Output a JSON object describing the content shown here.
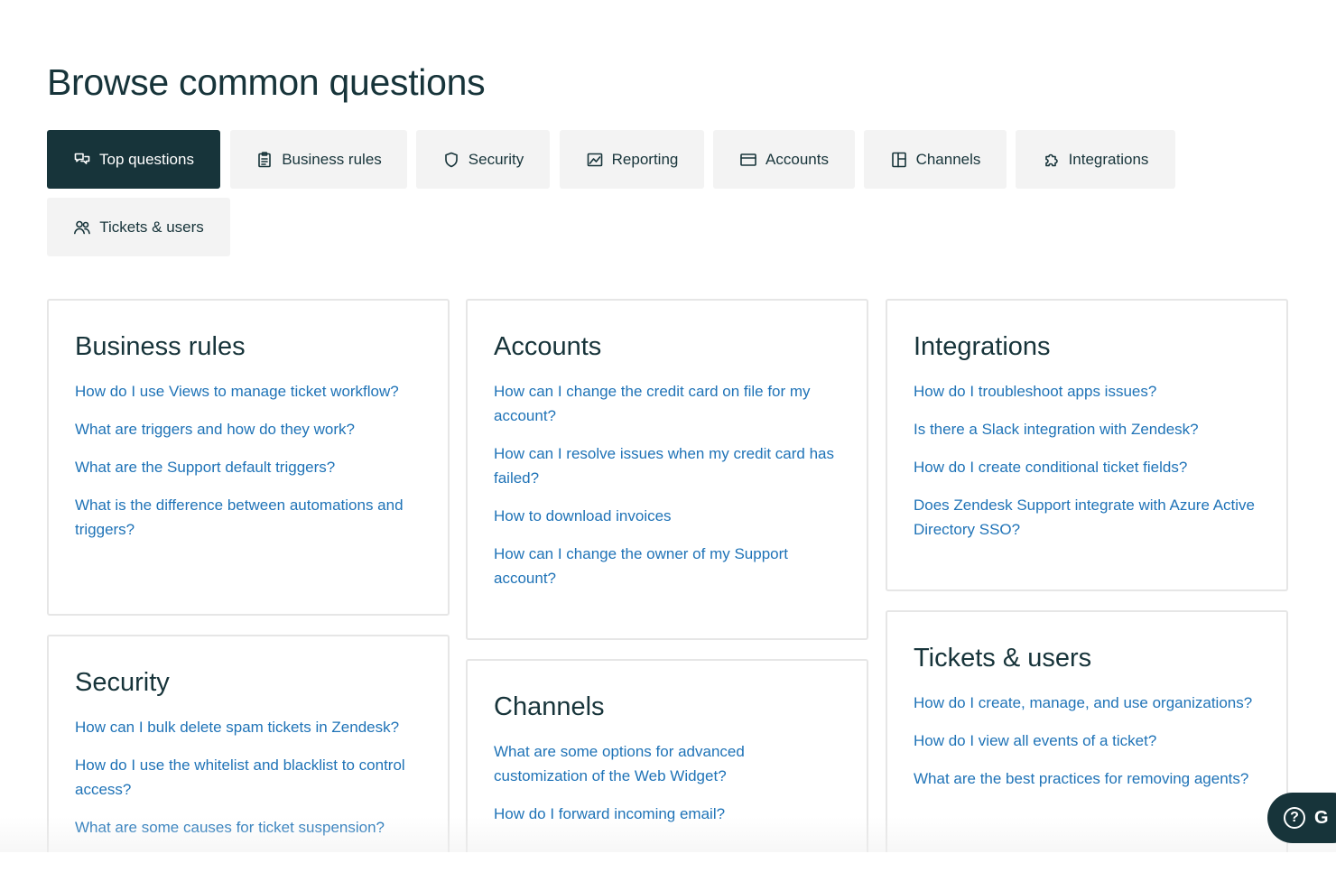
{
  "page": {
    "title": "Browse common questions"
  },
  "tabs": [
    {
      "label": "Top questions",
      "icon": "chat-bubbles-icon",
      "active": true
    },
    {
      "label": "Business rules",
      "icon": "clipboard-icon",
      "active": false
    },
    {
      "label": "Security",
      "icon": "shield-icon",
      "active": false
    },
    {
      "label": "Reporting",
      "icon": "chart-icon",
      "active": false
    },
    {
      "label": "Accounts",
      "icon": "credit-card-icon",
      "active": false
    },
    {
      "label": "Channels",
      "icon": "layout-icon",
      "active": false
    },
    {
      "label": "Integrations",
      "icon": "puzzle-icon",
      "active": false
    },
    {
      "label": "Tickets & users",
      "icon": "users-icon",
      "active": false
    }
  ],
  "cards": {
    "business_rules": {
      "title": "Business rules",
      "links": [
        "How do I use Views to manage ticket workflow?",
        "What are triggers and how do they work?",
        "What are the Support default triggers?",
        "What is the difference between automations and triggers?"
      ]
    },
    "accounts": {
      "title": "Accounts",
      "links": [
        "How can I change the credit card on file for my account?",
        "How can I resolve issues when my credit card has failed?",
        "How to download invoices",
        "How can I change the owner of my Support account?"
      ]
    },
    "integrations": {
      "title": "Integrations",
      "links": [
        "How do I troubleshoot apps issues?",
        "Is there a Slack integration with Zendesk?",
        "How do I create conditional ticket fields?",
        "Does Zendesk Support integrate with Azure Active Directory SSO?"
      ]
    },
    "security": {
      "title": "Security",
      "links": [
        "How can I bulk delete spam tickets in Zendesk?",
        "How do I use the whitelist and blacklist to control access?",
        "What are some causes for ticket suspension?"
      ]
    },
    "channels": {
      "title": "Channels",
      "links": [
        "What are some options for advanced customization of the Web Widget?",
        "How do I forward incoming email?"
      ]
    },
    "tickets_users": {
      "title": "Tickets & users",
      "links": [
        "How do I create, manage, and use organizations?",
        "How do I view all events of a ticket?",
        "What are the best practices for removing agents?"
      ]
    }
  },
  "help_widget": {
    "icon": "question-circle-icon",
    "label": "G"
  },
  "colors": {
    "brand_dark": "#17343a",
    "link_blue": "#1f73b7",
    "tab_bg": "#f3f3f3",
    "card_border": "#e6e6e6"
  }
}
